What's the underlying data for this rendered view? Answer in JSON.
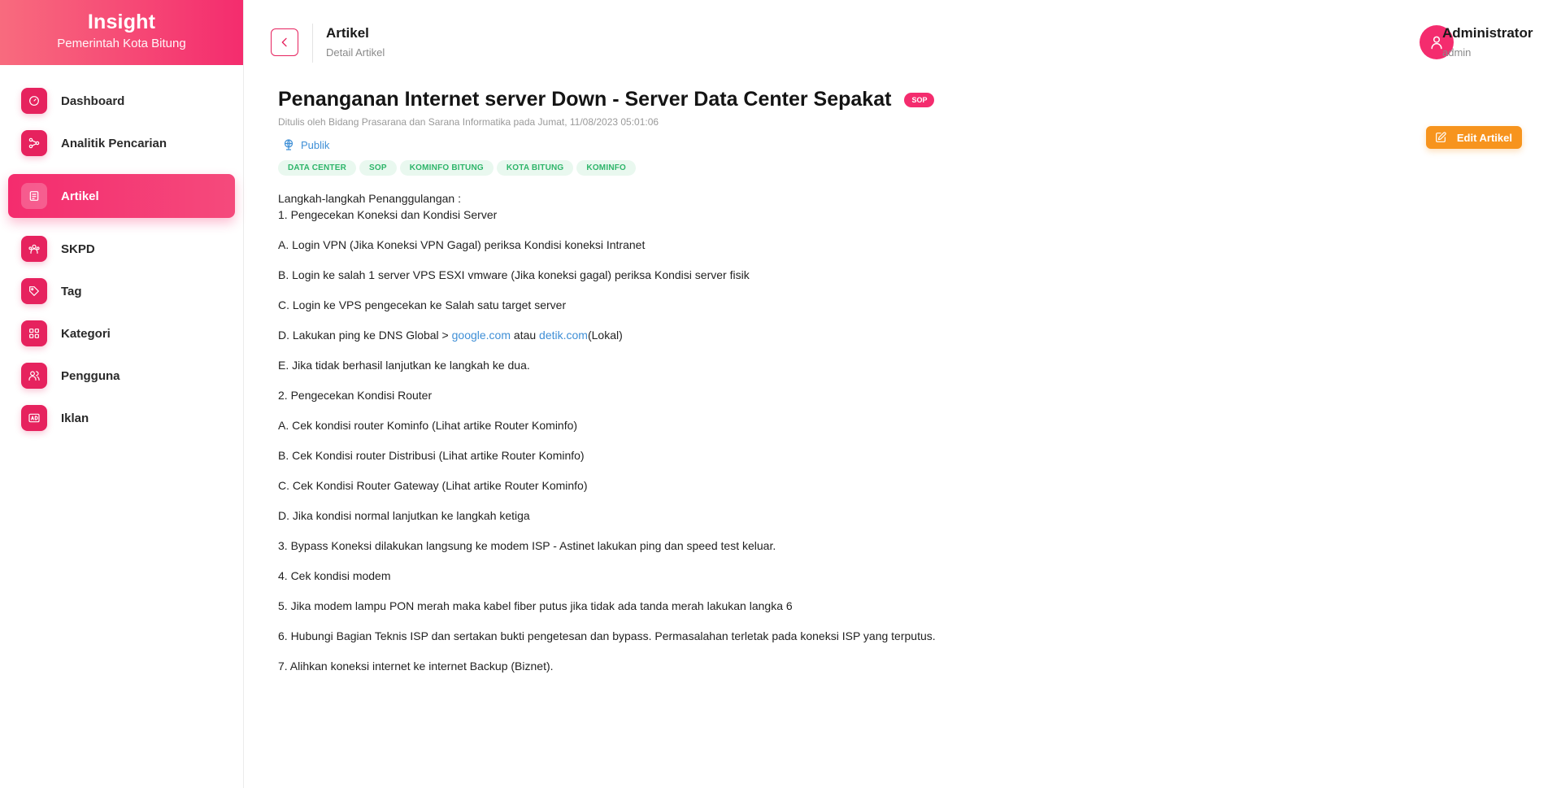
{
  "brand": {
    "title": "Insight",
    "subtitle": "Pemerintah Kota Bitung"
  },
  "colors": {
    "accent": "#f42c6e",
    "tag_green": "#2eb56a",
    "edit_orange": "#f7941d",
    "link_blue": "#3f8fd6"
  },
  "sidebar": {
    "items": [
      {
        "label": "Dashboard",
        "icon": "gauge-icon"
      },
      {
        "label": "Analitik Pencarian",
        "icon": "share-nodes-icon"
      },
      {
        "label": "Artikel",
        "icon": "document-icon",
        "active": true
      },
      {
        "label": "SKPD",
        "icon": "users-group-icon"
      },
      {
        "label": "Tag",
        "icon": "tag-icon"
      },
      {
        "label": "Kategori",
        "icon": "grid-icon"
      },
      {
        "label": "Pengguna",
        "icon": "users-icon"
      },
      {
        "label": "Iklan",
        "icon": "ad-icon"
      }
    ]
  },
  "header": {
    "title": "Artikel",
    "subtitle": "Detail Artikel"
  },
  "user": {
    "name": "Administrator",
    "role": "admin"
  },
  "article": {
    "title": "Penanganan Internet server Down - Server Data Center Sepakat",
    "badge": "SOP",
    "meta": "Ditulis oleh Bidang Prasarana dan Sarana Informatika pada Jumat, 11/08/2023 05:01:06",
    "visibility": "Publik",
    "edit_label": "Edit Artikel",
    "tags": [
      "DATA CENTER",
      "SOP",
      "KOMINFO BITUNG",
      "KOTA BITUNG",
      "KOMINFO"
    ],
    "lines": {
      "l0": "Langkah-langkah Penanggulangan :",
      "l1": "1. Pengecekan Koneksi dan Kondisi Server",
      "l2": "A. Login VPN  (Jika Koneksi VPN Gagal) periksa Kondisi koneksi Intranet",
      "l3": "B. Login ke salah 1 server VPS ESXI vmware (Jika koneksi gagal) periksa Kondisi server fisik",
      "l4": "C. Login ke VPS pengecekan ke Salah satu target server",
      "l5_prefix": "D. Lakukan ping ke DNS Global > ",
      "l5_link1": "google.com",
      "l5_mid": " atau ",
      "l5_link2": "detik.com",
      "l5_suffix": "(Lokal)",
      "l6": "E. Jika tidak berhasil lanjutkan ke langkah ke dua.",
      "l7": "2. Pengecekan Kondisi Router",
      "l8": "A. Cek kondisi router Kominfo (Lihat artike Router Kominfo)",
      "l9": "B. Cek Kondisi router Distribusi (Lihat artike Router Kominfo)",
      "l10": "C. Cek Kondisi Router Gateway (Lihat artike Router Kominfo)",
      "l11": "D. Jika kondisi normal lanjutkan ke langkah ketiga",
      "l12": "3. Bypass Koneksi dilakukan langsung ke modem ISP - Astinet lakukan ping dan speed test keluar.",
      "l13": "4. Cek kondisi modem",
      "l14": "5. Jika modem lampu PON merah maka kabel fiber putus jika tidak ada tanda merah lakukan langka 6",
      "l15": "6. Hubungi Bagian Teknis ISP dan sertakan bukti pengetesan dan bypass. Permasalahan terletak pada koneksi ISP yang terputus.",
      "l16": "7. Alihkan koneksi internet ke internet Backup (Biznet)."
    }
  }
}
